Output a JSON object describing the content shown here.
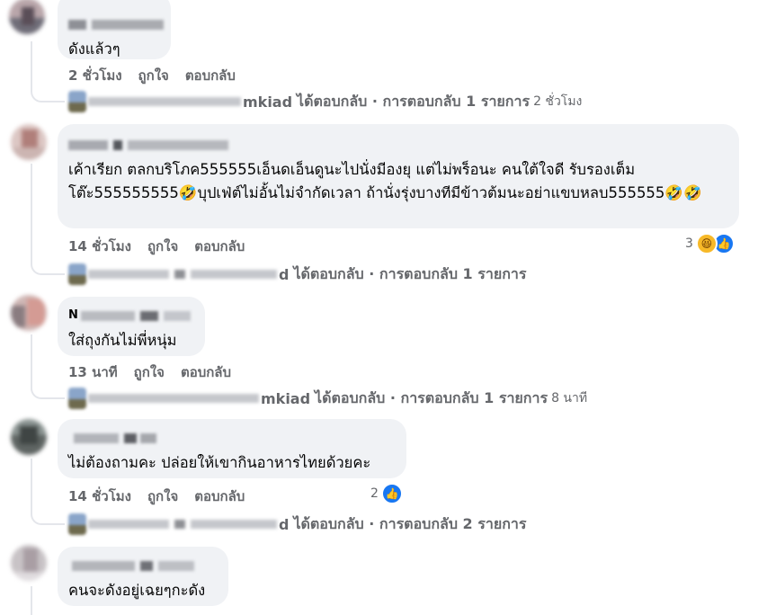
{
  "comments": [
    {
      "text": "ดังแล้วๆ",
      "time": "2 ชั่วโมง",
      "like_label": "ถูกใจ",
      "reply_label": "ตอบกลับ",
      "reply_summary": {
        "name_fragment": "mkiad",
        "text": "ได้ตอบกลับ · การตอบกลับ 1 รายการ",
        "time": "2 ชั่วโมง"
      }
    },
    {
      "text": "เค้าเรียก ตลกบริโภค555555เอ็นดเอ็นดูนะไปนั่งมีองยุ แต่ไม่พร็อนะ คนใต้ใจดี รับรองเต็มโต๊ะ555555555🤣บุปเฟ่ต์ไม่อั้นไม่จำกัดเวลา ถ้านั่งรุ่งบางทีมีข้าวต้มนะอย่าแขบหลบ555555🤣🤣",
      "time": "14 ชั่วโมง",
      "like_label": "ถูกใจ",
      "reply_label": "ตอบกลับ",
      "reaction_count": "3",
      "reply_summary": {
        "name_fragment": "d",
        "text": "ได้ตอบกลับ · การตอบกลับ 1 รายการ",
        "time": ""
      }
    },
    {
      "author_initial": "N",
      "text": "ใส่ถุงกันไม่พี่หนุ่ม",
      "time": "13 นาที",
      "like_label": "ถูกใจ",
      "reply_label": "ตอบกลับ",
      "reply_summary": {
        "name_fragment": "mkiad",
        "text": "ได้ตอบกลับ · การตอบกลับ 1 รายการ",
        "time": "8 นาที"
      }
    },
    {
      "text": "ไม่ต้องถามคะ ปล่อยให้เขากินอาหารไทยด้วยคะ",
      "time": "14 ชั่วโมง",
      "like_label": "ถูกใจ",
      "reply_label": "ตอบกลับ",
      "reaction_count": "2",
      "reply_summary": {
        "name_fragment": "d",
        "text": "ได้ตอบกลับ · การตอบกลับ 2 รายการ",
        "time": ""
      }
    },
    {
      "text": "คนจะดังอยู่เฉยๆกะดัง"
    }
  ],
  "colors": {
    "bubble": "#f0f2f5",
    "meta_text": "#65676b",
    "like_blue": "#1877f2",
    "haha_yellow": "#f7b928"
  }
}
